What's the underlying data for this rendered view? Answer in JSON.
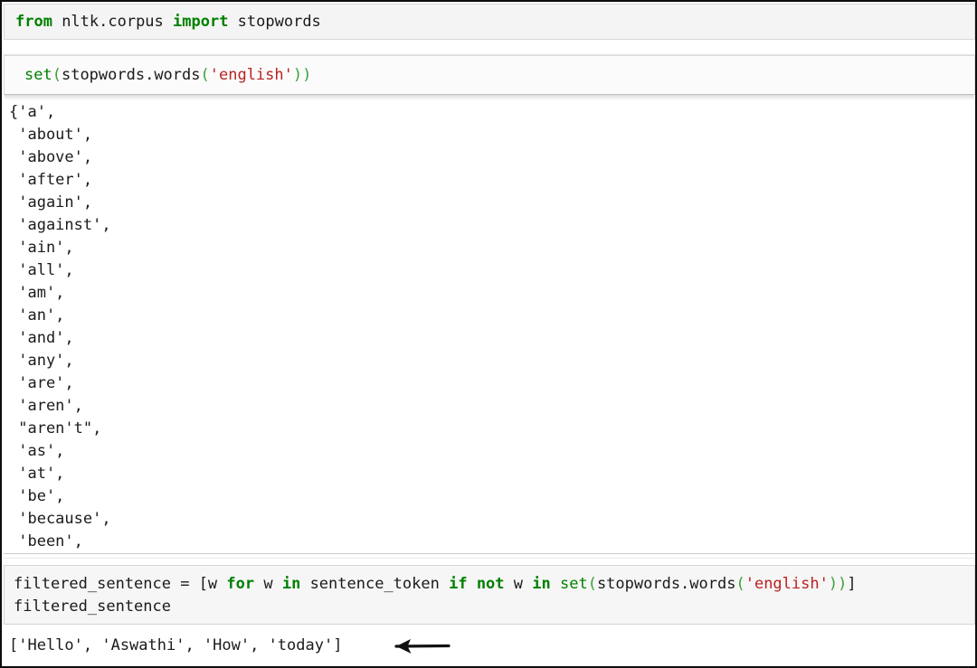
{
  "app": {
    "kind": "jupyter-notebook",
    "language": "python"
  },
  "colors": {
    "keyword": "#008000",
    "builtin": "#008000",
    "string": "#ba2121",
    "text": "#1b1b1b",
    "cell_background": "#f7f7f7",
    "cell_border": "#cfcfcf",
    "page_background": "#ffffff",
    "frame_border": "#0d0d0d"
  },
  "cells": {
    "import_cell": {
      "tokens": {
        "kw_from": "from",
        "module": " nltk.corpus ",
        "kw_import": "import",
        "name": " stopwords"
      },
      "plain_text": "from nltk.corpus import stopwords"
    },
    "set_cell": {
      "tokens": {
        "builtin": "set",
        "open_paren": "(",
        "expr": "stopwords.words",
        "inner_open": "(",
        "string": "'english'",
        "inner_close": ")",
        "close_paren": ")"
      },
      "plain_text": "set(stopwords.words('english'))"
    },
    "filter_cell": {
      "tokens": {
        "assign": "filtered_sentence = [w ",
        "kw_for": "for",
        "var_w": " w ",
        "kw_in1": "in",
        "iterable": " sentence_token ",
        "kw_if": "if",
        "kw_not": " not",
        "var_w2": " w ",
        "kw_in2": "in",
        "builtin": " set",
        "open_paren": "(",
        "expr": "stopwords.words",
        "inner_open": "(",
        "string": "'english'",
        "inner_close": ")",
        "close_paren": ")",
        "bracket_close": "]"
      },
      "line2": "filtered_sentence",
      "plain_text": "filtered_sentence = [w for w in sentence_token if not w in set(stopwords.words('english'))]"
    }
  },
  "outputs": {
    "stopwords_set": {
      "lines": [
        "{'a',",
        " 'about',",
        " 'above',",
        " 'after',",
        " 'again',",
        " 'against',",
        " 'ain',",
        " 'all',",
        " 'am',",
        " 'an',",
        " 'and',",
        " 'any',",
        " 'are',",
        " 'aren',",
        " \"aren't\",",
        " 'as',",
        " 'at',",
        " 'be',",
        " 'because',",
        " 'been',"
      ],
      "truncated": true
    },
    "filtered_sentence": {
      "text": "['Hello', 'Aswathi', 'How', 'today']",
      "items": [
        "Hello",
        "Aswathi",
        "How",
        "today"
      ]
    }
  },
  "annotation": {
    "arrow": {
      "icon": "left-arrow-icon",
      "direction": "left",
      "points_at": "filtered-sentence-output"
    }
  }
}
